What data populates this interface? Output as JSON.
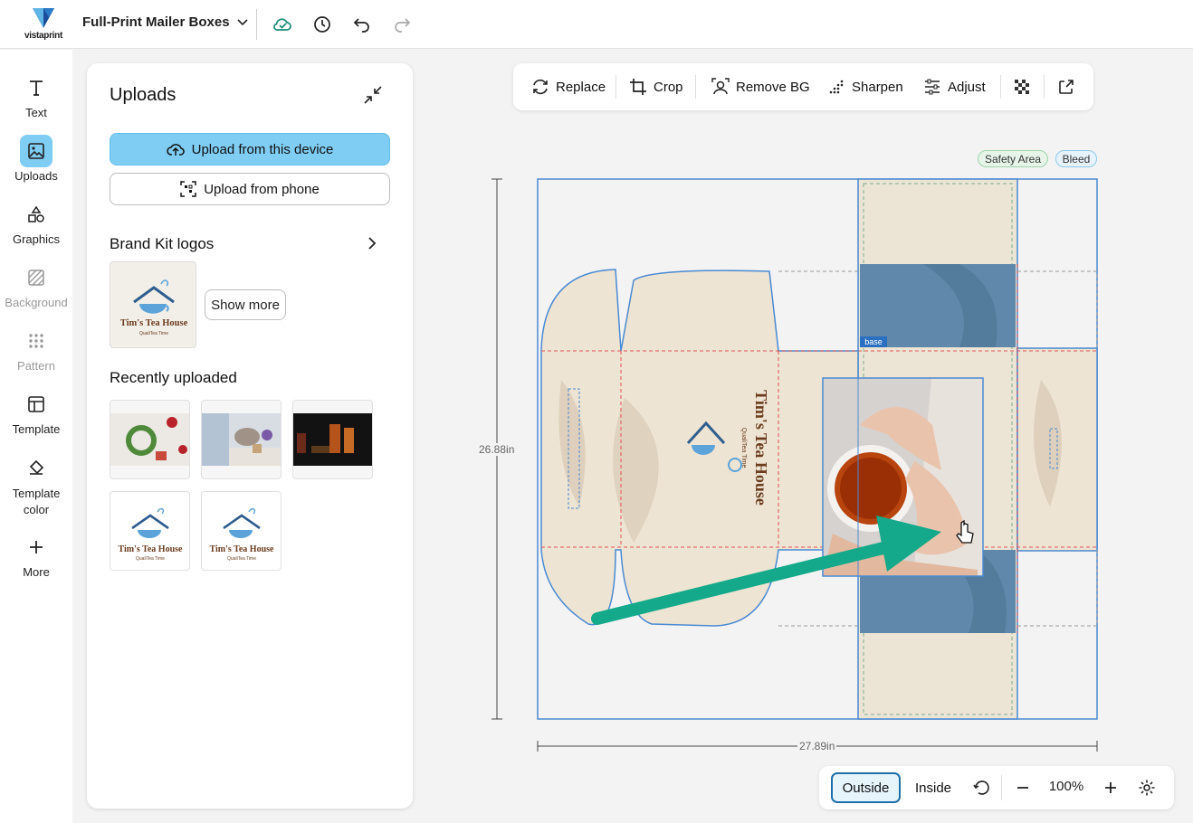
{
  "brand": {
    "logo_text": "vistaprint",
    "accent": "#7fcdf3",
    "teal_arrow": "#13a98a"
  },
  "header": {
    "product_name": "Full-Print Mailer Boxes",
    "icons": [
      "cloud-saved-icon",
      "history-icon",
      "undo-icon",
      "redo-icon"
    ]
  },
  "rail": {
    "items": [
      {
        "label": "Text",
        "icon": "text-icon"
      },
      {
        "label": "Uploads",
        "icon": "image-icon"
      },
      {
        "label": "Graphics",
        "icon": "shapes-icon"
      },
      {
        "label": "Background",
        "icon": "hatch-icon"
      },
      {
        "label": "Pattern",
        "icon": "dots-grid-icon"
      },
      {
        "label": "Template",
        "icon": "template-icon"
      },
      {
        "label": "Template color",
        "icon": "paint-bucket-icon"
      },
      {
        "label": "More",
        "icon": "plus-icon"
      }
    ]
  },
  "panel": {
    "title": "Uploads",
    "upload_device": "Upload from this device",
    "upload_phone": "Upload from phone",
    "brand_kit_title": "Brand Kit logos",
    "show_more": "Show more",
    "recent_title": "Recently uploaded",
    "logo_name": "Tim's Tea House",
    "logo_tagline": "QualiTea Time"
  },
  "toolbar": {
    "replace": "Replace",
    "crop": "Crop",
    "remove_bg": "Remove BG",
    "sharpen": "Sharpen",
    "adjust": "Adjust"
  },
  "canvas": {
    "safety_area": "Safety Area",
    "bleed": "Bleed",
    "height_label": "26.88in",
    "width_label": "27.89in",
    "selection_tag": "base",
    "box_title": "Tim's Tea House",
    "box_tagline": "QualiTea Time"
  },
  "bottom": {
    "outside": "Outside",
    "inside": "Inside",
    "zoom": "100%"
  }
}
